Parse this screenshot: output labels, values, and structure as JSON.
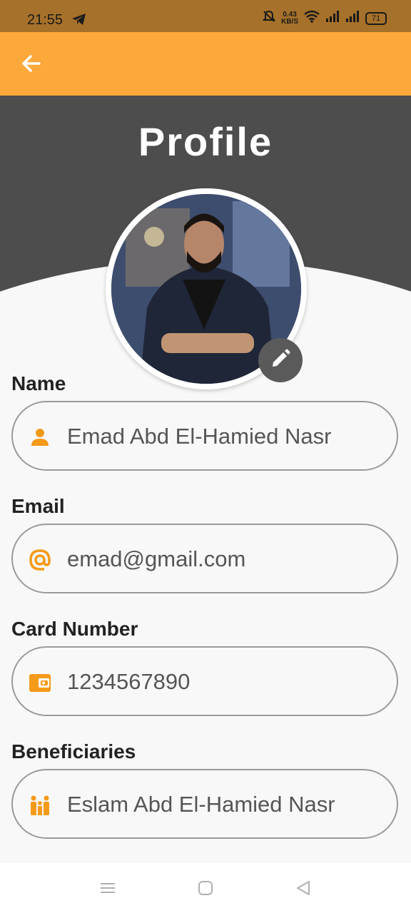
{
  "status_bar": {
    "time": "21:55",
    "speed_value": "0.43",
    "speed_unit": "KB/S",
    "battery": "71",
    "icons": [
      "telegram-icon",
      "mute-icon",
      "wifi-icon",
      "signal-icon",
      "signal-icon",
      "battery-icon"
    ]
  },
  "app_bar": {
    "back_icon": "arrow-left-icon",
    "color": "#fda83a"
  },
  "header": {
    "title": "Profile",
    "background": "#4d4d4d"
  },
  "avatar": {
    "edit_icon": "pencil-icon"
  },
  "fields": [
    {
      "label": "Name",
      "value": "Emad Abd El-Hamied Nasr",
      "icon": "person-icon"
    },
    {
      "label": "Email",
      "value": "emad@gmail.com",
      "icon": "at-icon"
    },
    {
      "label": "Card Number",
      "value": "1234567890",
      "icon": "wallet-icon"
    },
    {
      "label": "Beneficiaries",
      "value": "Eslam Abd El-Hamied Nasr",
      "icon": "family-icon"
    }
  ],
  "nav_bar": {
    "icons": [
      "menu-icon",
      "home-icon",
      "back-icon"
    ]
  },
  "colors": {
    "accent": "#fda83a",
    "icon": "#f59a19"
  }
}
